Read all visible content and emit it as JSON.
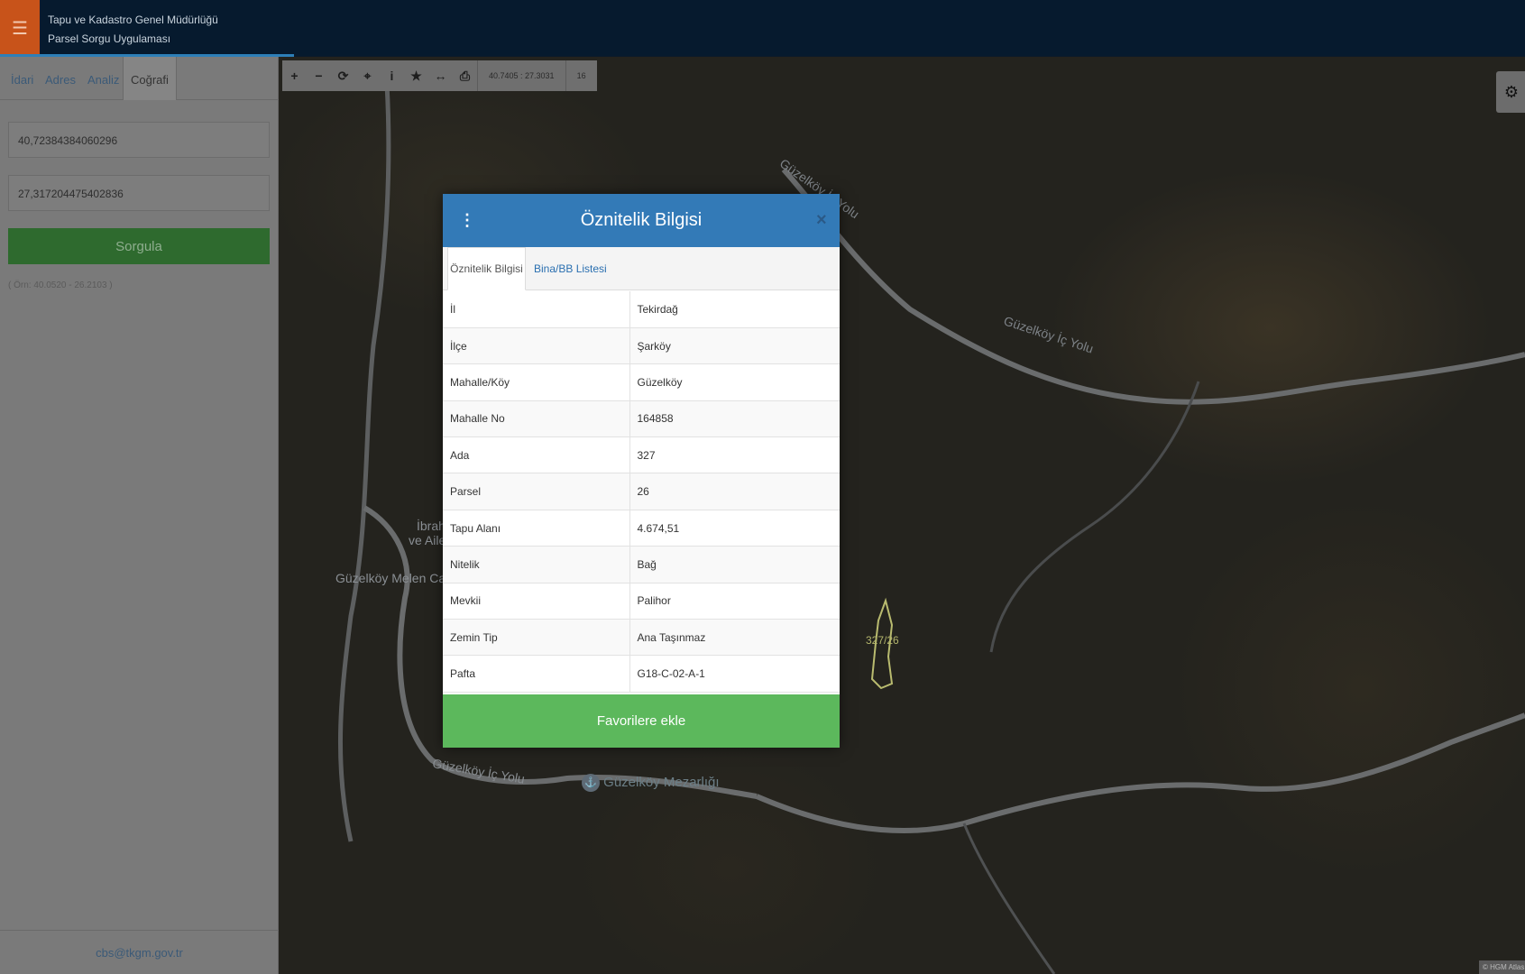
{
  "header": {
    "menu_icon": "hamburger-icon",
    "title_line1": "Tapu ve Kadastro Genel Müdürlüğü",
    "title_line2": "Parsel Sorgu Uygulaması",
    "colors": {
      "bar": "#061a2e",
      "menu": "#c8531a"
    }
  },
  "sidebar": {
    "tabs": [
      "İdari",
      "Adres",
      "Analiz",
      "Coğrafi"
    ],
    "active_tab": "Coğrafi",
    "latitude_value": "40,72384384060296",
    "longitude_value": "27,317204475402836",
    "query_button": "Sorgula",
    "hint": "( Örn: 40.0520 - 26.2103 )",
    "footer_email": "cbs@tkgm.gov.tr"
  },
  "map": {
    "toolbar": {
      "icons": [
        "zoom-in-icon",
        "zoom-out-icon",
        "refresh-icon",
        "locate-icon",
        "info-icon",
        "favorite-star-icon",
        "measure-icon",
        "print-icon"
      ],
      "coordinates": "40.7405 : 27.3031",
      "zoom_level": "16"
    },
    "labels": {
      "road1": "Güzelköy İç Yolu",
      "road2": "Güzelköy İç Yolu",
      "road3": "Güzelköy İç Yolu",
      "place1": "İbrah",
      "place2": "ve Aile",
      "place3": "Güzelköy Melen Cam",
      "cemetery": "Güzelköy Mezarlığı",
      "parcel": "327/26"
    },
    "attribution": "© HGM Atlas",
    "settings_icon": "gear-icon"
  },
  "modal": {
    "title": "Öznitelik Bilgisi",
    "close_label": "×",
    "tabs": [
      "Öznitelik Bilgisi",
      "Bina/BB Listesi"
    ],
    "rows": [
      {
        "key": "İl",
        "value": "Tekirdağ"
      },
      {
        "key": "İlçe",
        "value": "Şarköy"
      },
      {
        "key": "Mahalle/Köy",
        "value": "Güzelköy"
      },
      {
        "key": "Mahalle No",
        "value": "164858"
      },
      {
        "key": "Ada",
        "value": "327"
      },
      {
        "key": "Parsel",
        "value": "26"
      },
      {
        "key": "Tapu Alanı",
        "value": "4.674,51"
      },
      {
        "key": "Nitelik",
        "value": "Bağ"
      },
      {
        "key": "Mevkii",
        "value": "Palihor"
      },
      {
        "key": "Zemin Tip",
        "value": "Ana Taşınmaz"
      },
      {
        "key": "Pafta",
        "value": "G18-C-02-A-1"
      }
    ],
    "favorite_button": "Favorilere ekle",
    "colors": {
      "header": "#337ab7",
      "button": "#5cb85c"
    }
  }
}
